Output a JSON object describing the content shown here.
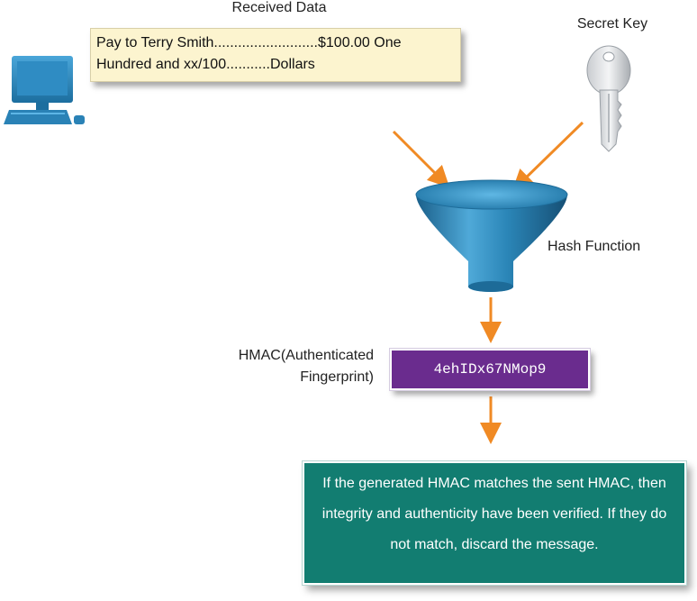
{
  "received": {
    "title": "Received Data",
    "line1": "Pay to Terry Smith..........................$100.00 One",
    "line2": "Hundred and xx/100...........Dollars"
  },
  "secret_key": {
    "label": "Secret Key"
  },
  "hash_function": {
    "label": "Hash Function"
  },
  "hmac": {
    "label_line1": "HMAC(Authenticated",
    "label_line2": "Fingerprint)",
    "value": "4ehIDx67NMop9"
  },
  "result": {
    "text": "If the generated HMAC matches the sent HMAC, then integrity and authenticity have been verified. If they do not match, discard the message."
  },
  "colors": {
    "arrow": "#f08a24",
    "funnel": "#2b86b8",
    "hmac_box": "#6a2c8e",
    "result_box": "#127d71",
    "received_box": "#fcf4cf"
  }
}
